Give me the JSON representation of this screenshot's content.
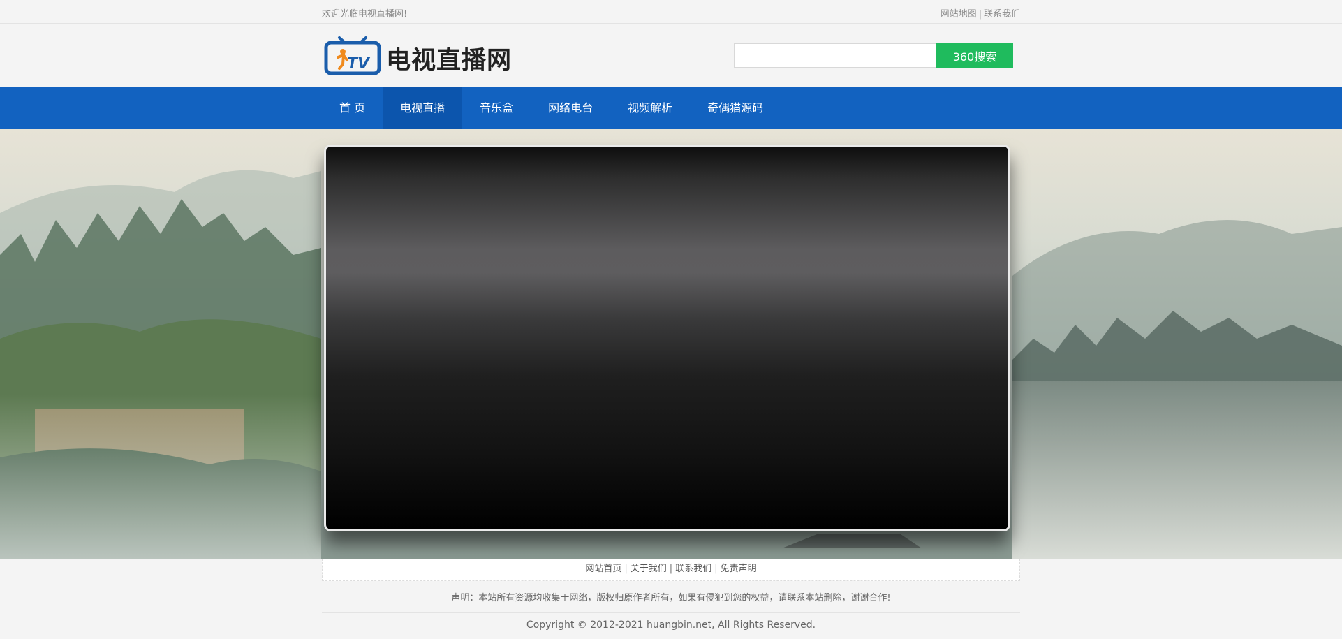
{
  "topbar": {
    "welcome": "欢迎光临电视直播网!",
    "links": [
      "网站地图",
      "联系我们"
    ],
    "separator": "|"
  },
  "header": {
    "logo_text": "电视直播网",
    "logo_icon_text": "TV",
    "search_placeholder": "",
    "search_value": "",
    "search_button": "360搜索"
  },
  "nav": {
    "items": [
      {
        "label": "首 页",
        "active": false
      },
      {
        "label": "电视直播",
        "active": true
      },
      {
        "label": "音乐盒",
        "active": false
      },
      {
        "label": "网络电台",
        "active": false
      },
      {
        "label": "视频解析",
        "active": false
      },
      {
        "label": "奇偶猫源码",
        "active": false
      }
    ]
  },
  "footer": {
    "links": [
      "网站首页",
      "关于我们",
      "联系我们",
      "免责声明"
    ],
    "separator": "|",
    "statement": "声明：本站所有资源均收集于网络，版权归原作者所有，如果有侵犯到您的权益，请联系本站删除，谢谢合作!",
    "copyright": "Copyright © 2012-2021 huangbin.net, All Rights Reserved."
  },
  "colors": {
    "nav_bg": "#1262c0",
    "nav_active": "#0c55ad",
    "search_button": "#1fbb5d",
    "logo_blue": "#1a5dab",
    "logo_orange": "#f08a1c"
  }
}
